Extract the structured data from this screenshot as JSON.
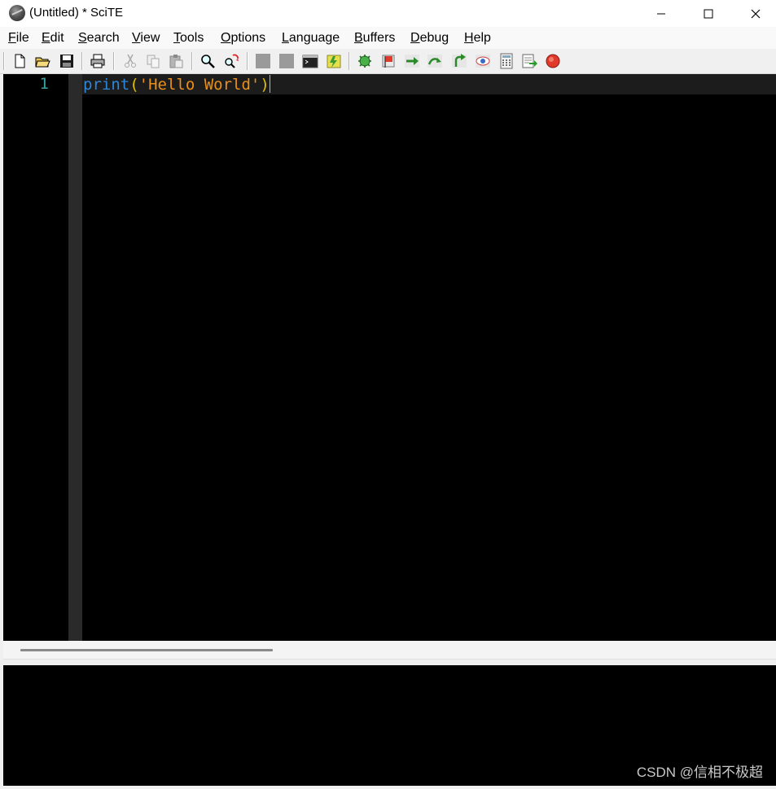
{
  "window": {
    "title": "(Untitled) * SciTE"
  },
  "menu": [
    {
      "accel": "F",
      "rest": "ile"
    },
    {
      "accel": "E",
      "rest": "dit"
    },
    {
      "accel": "S",
      "rest": "earch"
    },
    {
      "accel": "V",
      "rest": "iew"
    },
    {
      "accel": "T",
      "rest": "ools"
    },
    {
      "accel": "O",
      "rest": "ptions"
    },
    {
      "accel": "L",
      "rest": "anguage"
    },
    {
      "accel": "B",
      "rest": "uffers"
    },
    {
      "accel": "D",
      "rest": "ebug"
    },
    {
      "accel": "H",
      "rest": "elp"
    }
  ],
  "toolbar": [
    "new-file-icon",
    "open-folder-icon",
    "save-icon",
    "print-icon",
    "cut-icon",
    "copy-icon",
    "paste-icon",
    "find-icon",
    "replace-icon",
    "stop-icon",
    "compile-icon",
    "terminal-icon",
    "build-icon",
    "run-icon",
    "toggle-breakpoint-icon",
    "step-icon",
    "step-over-icon",
    "step-out-icon",
    "watch-icon",
    "calculator-icon",
    "output-icon",
    "record-icon"
  ],
  "editor": {
    "line_number": "1",
    "code": {
      "keyword": "print",
      "open_paren": "(",
      "string": "'Hello World'",
      "close_paren": ")"
    }
  },
  "colors": {
    "keyword": "#2e86d8",
    "string": "#e8901a",
    "brace": "#e0c000",
    "line_number": "#3aa0a0",
    "editor_background": "#000000"
  },
  "watermark": "CSDN @信相不极超"
}
